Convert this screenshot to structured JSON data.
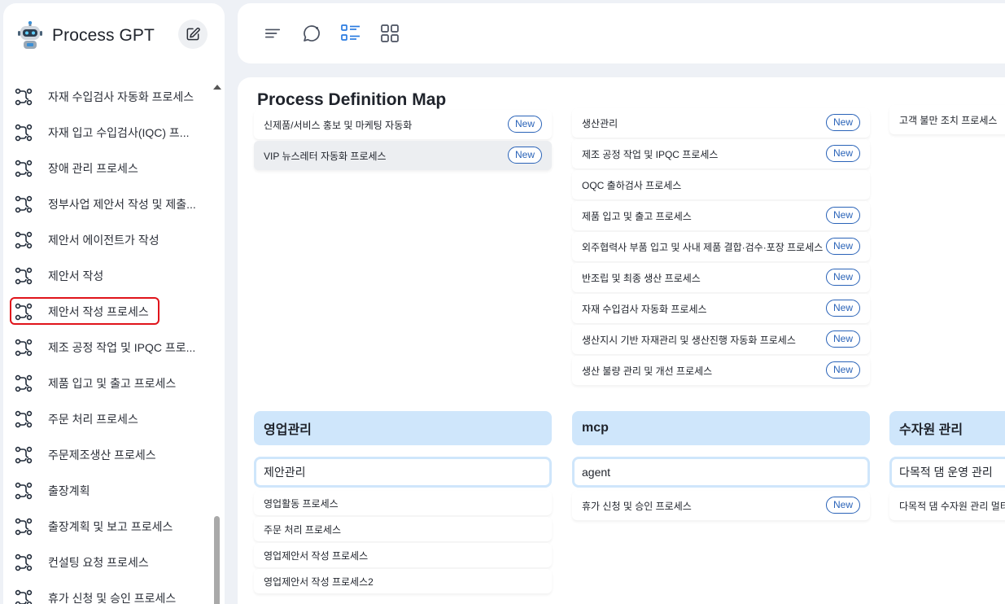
{
  "app": {
    "name": "Process GPT"
  },
  "sidebar": {
    "items": [
      {
        "label": "자재 수입검사 자동화 프로세스"
      },
      {
        "label": "자재 입고 수입검사(IQC) 프..."
      },
      {
        "label": "장애 관리 프로세스"
      },
      {
        "label": "정부사업 제안서 작성 및 제출..."
      },
      {
        "label": "제안서 에이전트가 작성"
      },
      {
        "label": "제안서 작성"
      },
      {
        "label": "제안서 작성 프로세스"
      },
      {
        "label": "제조 공정 작업 및 IPQC 프로..."
      },
      {
        "label": "제품 입고 및 출고 프로세스"
      },
      {
        "label": "주문 처리 프로세스"
      },
      {
        "label": "주문제조생산 프로세스"
      },
      {
        "label": "출장계획"
      },
      {
        "label": "출장계획 및 보고 프로세스"
      },
      {
        "label": "컨설팅 요청 프로세스"
      },
      {
        "label": "휴가 신청 및 승인 프로세스"
      }
    ],
    "selected_index": 6,
    "icon": "process-flow-icon"
  },
  "topbar": {
    "icons": [
      "menu-icon",
      "chat-bubble-icon",
      "list-view-icon",
      "grid-view-icon"
    ],
    "active": "list-view-icon"
  },
  "main": {
    "title": "Process Definition Map",
    "badge_label": "New",
    "col1_top": [
      {
        "label": "신제품/서비스 홍보 및 마케팅 자동화",
        "new": true
      },
      {
        "label": "VIP 뉴스레터 자동화 프로세스",
        "new": true
      }
    ],
    "col2_top": [
      {
        "label": "생산관리",
        "new": true
      },
      {
        "label": "제조 공정 작업 및 IPQC 프로세스",
        "new": true
      },
      {
        "label": "OQC 출하검사 프로세스",
        "new": false
      },
      {
        "label": "제품 입고 및 출고 프로세스",
        "new": true
      },
      {
        "label": "외주협력사 부품 입고 및 사내 제품 결합·검수·포장 프로세스",
        "new": true
      },
      {
        "label": "반조립 및 최종 생산 프로세스",
        "new": true
      },
      {
        "label": "자재 수입검사 자동화 프로세스",
        "new": true
      },
      {
        "label": "생산지시 기반 자재관리 및 생산진행 자동화 프로세스",
        "new": true
      },
      {
        "label": "생산 불량 관리 및 개선 프로세스",
        "new": true
      }
    ],
    "col3_top": [
      {
        "label": "고객 불만 조치 프로세스",
        "new": false
      }
    ],
    "categories": [
      {
        "title": "영업관리",
        "subtitle": "제안관리",
        "items": [
          {
            "label": "영업활동 프로세스",
            "new": false
          },
          {
            "label": "주문 처리 프로세스",
            "new": false
          },
          {
            "label": "영업제안서 작성 프로세스",
            "new": false
          },
          {
            "label": "영업제안서 작성 프로세스2",
            "new": false
          }
        ]
      },
      {
        "title": "mcp",
        "subtitle": "agent",
        "items": [
          {
            "label": "휴가 신청 및 승인 프로세스",
            "new": true
          }
        ]
      },
      {
        "title": "수자원 관리",
        "subtitle": "다목적 댐 운영 관리",
        "items": [
          {
            "label": "다목적 댐 수자원 관리 멀티",
            "new": false
          }
        ]
      }
    ]
  }
}
